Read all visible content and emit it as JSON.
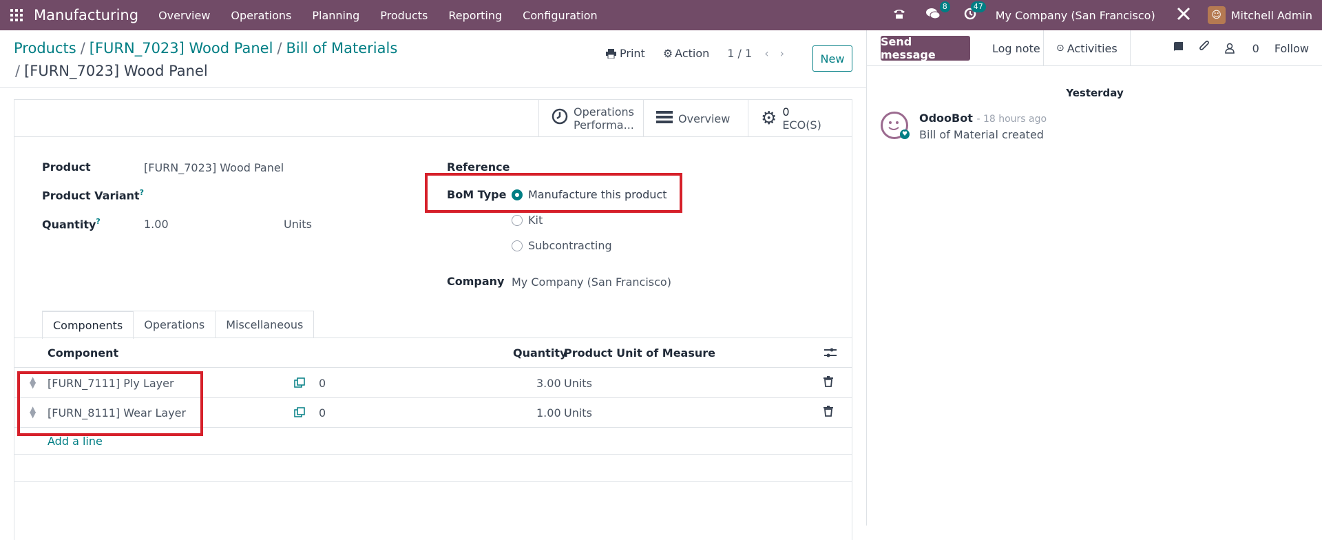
{
  "topbar": {
    "app_name": "Manufacturing",
    "menu": [
      "Overview",
      "Operations",
      "Planning",
      "Products",
      "Reporting",
      "Configuration"
    ],
    "messages_count": "8",
    "activities_count": "47",
    "company": "My Company (San Francisco)",
    "user": "Mitchell Admin"
  },
  "breadcrumb": {
    "items": [
      "Products",
      "[FURN_7023] Wood Panel",
      "Bill of Materials"
    ],
    "current": "[FURN_7023] Wood Panel"
  },
  "control": {
    "print_label": "Print",
    "action_label": "Action",
    "pager": "1 / 1",
    "new_label": "New"
  },
  "smart_buttons": {
    "operations_perf": {
      "line1": "Operations",
      "line2": "Performa..."
    },
    "overview": "Overview",
    "ecos": {
      "count": "0",
      "label": "ECO(S)"
    }
  },
  "form": {
    "product_label": "Product",
    "product_value": "[FURN_7023] Wood Panel",
    "variant_label": "Product Variant",
    "quantity_label": "Quantity",
    "quantity_value": "1.00",
    "quantity_uom": "Units",
    "help_mark": "?",
    "reference_label": "Reference",
    "bom_type_label": "BoM Type",
    "bom_type_options": [
      "Manufacture this product",
      "Kit",
      "Subcontracting"
    ],
    "bom_type_selected": "Manufacture this product",
    "company_label": "Company",
    "company_value": "My Company (San Francisco)"
  },
  "tabs": [
    "Components",
    "Operations",
    "Miscellaneous"
  ],
  "table": {
    "headers": {
      "component": "Component",
      "quantity": "Quantity",
      "uom": "Product Unit of Measure"
    },
    "rows": [
      {
        "component": "[FURN_7111] Ply Layer",
        "forecast": "0",
        "quantity": "3.00",
        "uom": "Units"
      },
      {
        "component": "[FURN_8111] Wear Layer",
        "forecast": "0",
        "quantity": "1.00",
        "uom": "Units"
      }
    ],
    "add_line": "Add a line"
  },
  "chatter": {
    "send_message": "Send message",
    "log_note": "Log note",
    "activities": "Activities",
    "followers_count": "0",
    "follow": "Follow",
    "date_separator": "Yesterday",
    "message": {
      "author": "OdooBot",
      "time": "- 18 hours ago",
      "body": "Bill of Material created"
    }
  },
  "colors": {
    "brand": "#714B67",
    "accent": "#017e84",
    "highlight": "#d6202a"
  }
}
